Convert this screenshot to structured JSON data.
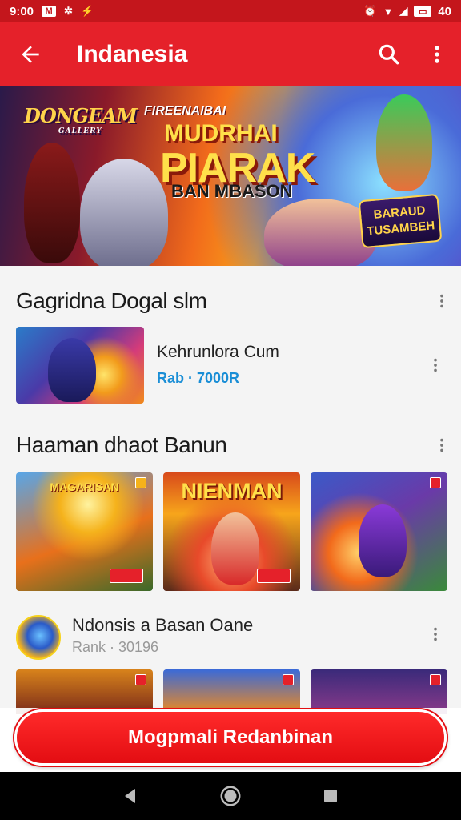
{
  "status_bar": {
    "time": "9:00",
    "battery": "40",
    "left_icons": [
      "gmail-icon",
      "settings-icon",
      "signal-icon"
    ],
    "right_icons": [
      "alarm-icon",
      "wifi-icon",
      "cell-signal-icon",
      "battery-icon"
    ]
  },
  "app_bar": {
    "title": "Indanesia",
    "back_icon": "arrow-back-icon",
    "search_icon": "search-icon",
    "menu_icon": "more-vert-icon",
    "color": "#e5212a"
  },
  "banner": {
    "logo_text": "DONGEAM",
    "logo_sub": "GALLERY",
    "kicker": "FIREENAIBAI",
    "headline_line1": "MUDRHAI",
    "headline_line2": "PIARAK",
    "subline": "BAN MBASON",
    "badge_line1": "BARAUD",
    "badge_line2": "TUSAMBEH"
  },
  "section1": {
    "title": "Gagridna Dogal slm",
    "featured": {
      "name": "Kehrunlora Cum",
      "meta": "Rab · 7000R"
    }
  },
  "section2": {
    "title": "Haaman dhaot Banun",
    "thumbs": [
      {
        "label": "MAGARISAN"
      },
      {
        "label": "NIENMAN"
      },
      {
        "label": ""
      }
    ]
  },
  "section3": {
    "name": "Ndonsis a Basan Oane",
    "meta": "Rank · 30196"
  },
  "cta": {
    "label": "Mogpmali Redanbinan"
  },
  "nav": {
    "back": "nav-back-icon",
    "home": "nav-home-icon",
    "recents": "nav-recents-icon"
  }
}
